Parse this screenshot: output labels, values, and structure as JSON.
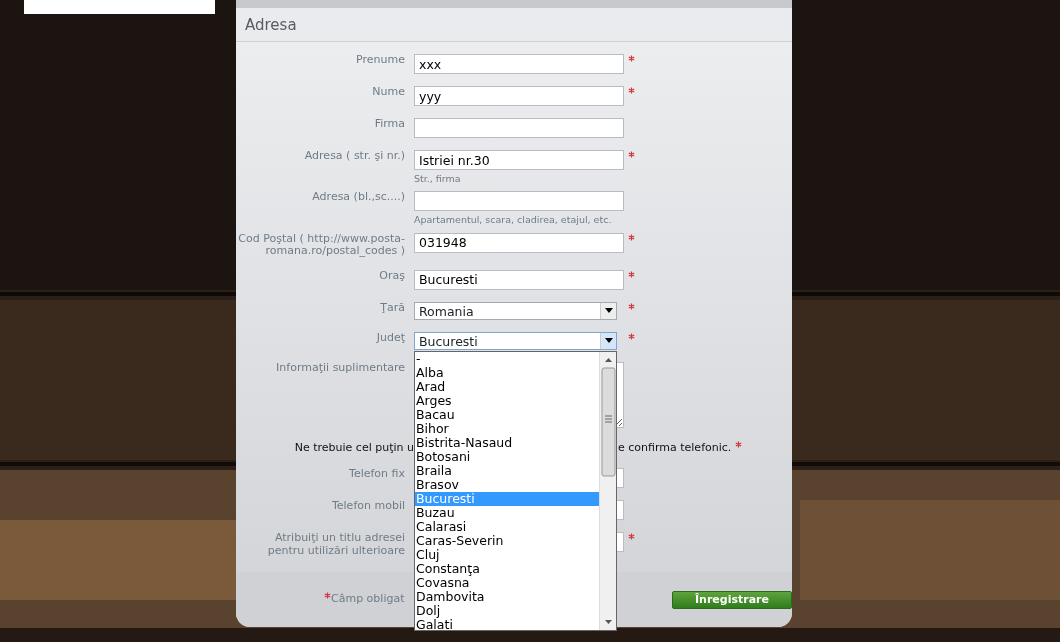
{
  "section_title": "Adresa",
  "fields": [
    {
      "kind": "text",
      "label": "Prenume",
      "value": "xxx",
      "required": true
    },
    {
      "kind": "text",
      "label": "Nume",
      "value": "yyy",
      "required": true
    },
    {
      "kind": "text",
      "label": "Firma",
      "required": false
    },
    {
      "kind": "text",
      "label": "Adresa ( str. şi nr.)",
      "value": "Istriei nr.30",
      "required": true,
      "hint": "Str., firma"
    },
    {
      "kind": "text",
      "label": "Adresa (bl.,sc....)",
      "required": false,
      "hint": "Apartamentul, scara, cladirea, etajul, etc."
    },
    {
      "kind": "text",
      "label": "Cod Poştal ( http://www.posta-romana.ro/postal_codes )",
      "value": "031948",
      "required": true
    },
    {
      "kind": "text",
      "label": "Oraş",
      "value": "Bucuresti",
      "required": true
    },
    {
      "kind": "select",
      "label": "Ţară",
      "value": "Romania",
      "required": true,
      "expanded": false
    },
    {
      "kind": "select",
      "label": "Judeţ",
      "value": "Bucuresti",
      "required": true,
      "expanded": true,
      "options": [
        {
          "label": "-",
          "selected": false
        },
        {
          "label": "Alba",
          "selected": false
        },
        {
          "label": "Arad",
          "selected": false
        },
        {
          "label": "Arges",
          "selected": false
        },
        {
          "label": "Bacau",
          "selected": false
        },
        {
          "label": "Bihor",
          "selected": false
        },
        {
          "label": "Bistrita-Nasaud",
          "selected": false
        },
        {
          "label": "Botosani",
          "selected": false
        },
        {
          "label": "Braila",
          "selected": false
        },
        {
          "label": "Brasov",
          "selected": false
        },
        {
          "label": "Bucuresti",
          "selected": true
        },
        {
          "label": "Buzau",
          "selected": false
        },
        {
          "label": "Calarasi",
          "selected": false
        },
        {
          "label": "Caras-Severin",
          "selected": false
        },
        {
          "label": "Cluj",
          "selected": false
        },
        {
          "label": "Constanţa",
          "selected": false
        },
        {
          "label": "Covasna",
          "selected": false
        },
        {
          "label": "Dambovita",
          "selected": false
        },
        {
          "label": "Dolj",
          "selected": false
        },
        {
          "label": "Galati",
          "selected": false
        }
      ]
    },
    {
      "kind": "textarea",
      "label": "Informaţii suplimentare",
      "required": false
    },
    {
      "kind": "note",
      "text_start": "Ne trebuie cel puţin u",
      "text_end": "e confirma telefonic.",
      "required": true
    },
    {
      "kind": "text",
      "label": "Telefon fix",
      "required": false
    },
    {
      "kind": "text",
      "label": "Telefon mobil",
      "required": false
    },
    {
      "kind": "text",
      "label": "Atribuiţi un titlu adresei pentru utilizări ulterioare",
      "required": true
    }
  ],
  "footer": {
    "legend": "Câmp obligat",
    "button": "Înregistrare"
  }
}
